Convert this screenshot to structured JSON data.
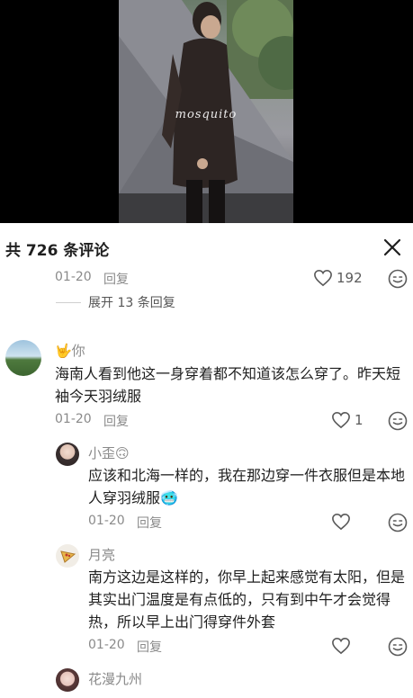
{
  "video": {
    "watermark": "mosquito"
  },
  "panel": {
    "title": "共 726 条评论"
  },
  "top_comment": {
    "date": "01-20",
    "reply_label": "回复",
    "likes": "192",
    "expand_label": "展开 13 条回复"
  },
  "comments": [
    {
      "user": "🤟你",
      "text": "海南人看到他这一身穿着都不知道该怎么穿了。昨天短袖今天羽绒服",
      "date": "01-20",
      "reply_label": "回复",
      "likes": "1"
    },
    {
      "user": "小歪🙃",
      "text": "应该和北海一样的，我在那边穿一件衣服但是本地人穿羽绒服🥶",
      "date": "01-20",
      "reply_label": "回复",
      "likes": ""
    },
    {
      "user": "月亮",
      "text": "南方这边是这样的，你早上起来感觉有太阳，但是其实出门温度是有点低的，只有到中午才会觉得热，所以早上出门得穿件外套",
      "date": "01-20",
      "reply_label": "回复",
      "likes": ""
    },
    {
      "user": "花漫九州",
      "text": "",
      "date": "",
      "reply_label": "",
      "likes": ""
    }
  ],
  "colors": {
    "text": "#1f1f1f",
    "meta": "#8a8a8a",
    "background": "#ffffff",
    "video_bg": "#000000"
  }
}
